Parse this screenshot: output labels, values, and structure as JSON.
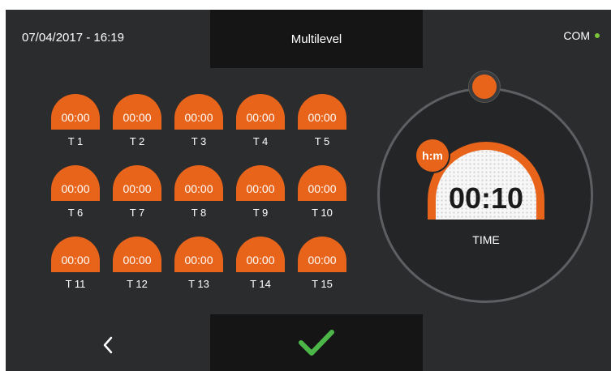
{
  "header": {
    "datetime": "07/04/2017 - 16:19",
    "title": "Multilevel",
    "com_label": "COM"
  },
  "timers": [
    {
      "value": "00:00",
      "label": "T 1"
    },
    {
      "value": "00:00",
      "label": "T 2"
    },
    {
      "value": "00:00",
      "label": "T 3"
    },
    {
      "value": "00:00",
      "label": "T 4"
    },
    {
      "value": "00:00",
      "label": "T 5"
    },
    {
      "value": "00:00",
      "label": "T 6"
    },
    {
      "value": "00:00",
      "label": "T 7"
    },
    {
      "value": "00:00",
      "label": "T 8"
    },
    {
      "value": "00:00",
      "label": "T 9"
    },
    {
      "value": "00:00",
      "label": "T 10"
    },
    {
      "value": "00:00",
      "label": "T 11"
    },
    {
      "value": "00:00",
      "label": "T 12"
    },
    {
      "value": "00:00",
      "label": "T 13"
    },
    {
      "value": "00:00",
      "label": "T 14"
    },
    {
      "value": "00:00",
      "label": "T 15"
    }
  ],
  "dial": {
    "unit": "h:m",
    "value": "00:10",
    "caption": "TIME"
  },
  "footer": {
    "back_icon": "chevron-left-icon",
    "confirm_icon": "checkmark-icon"
  },
  "colors": {
    "accent": "#e8641b",
    "background": "#2b2c2e",
    "panel": "#151516",
    "status_ok": "#7ec43b",
    "confirm": "#4cb648"
  }
}
